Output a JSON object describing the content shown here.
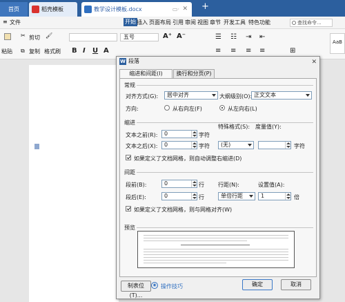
{
  "tabs": {
    "home": "首页",
    "template": "稻壳模板",
    "document": "教学设计模板.docx",
    "new_tab": "+"
  },
  "menu": {
    "items": [
      "文件",
      "开始",
      "插入",
      "页面布局",
      "引用",
      "审阅",
      "视图",
      "章节",
      "开发工具",
      "特色功能"
    ],
    "search_placeholder": "查找命令..."
  },
  "ribbon": {
    "cut": "剪切",
    "copy": "复制",
    "paste": "粘贴",
    "format_painter": "格式刷",
    "font_size": "五号",
    "style_preview": "AaB"
  },
  "dialog": {
    "title": "段落",
    "tabs": [
      "缩进和间距(I)",
      "换行和分页(P)"
    ],
    "general": {
      "section": "常规",
      "alignment_label": "对齐方式(G):",
      "alignment_value": "居中对齐",
      "outline_label": "大纲级别(O):",
      "outline_value": "正文文本",
      "direction_label": "方向:",
      "rtl_label": "从右向左(F)",
      "ltr_label": "从左向右(L)",
      "direction_selected": "ltr"
    },
    "indent": {
      "section": "缩进",
      "before_label": "文本之前(R):",
      "before_value": "0",
      "before_unit": "字符",
      "after_label": "文本之后(X):",
      "after_value": "0",
      "after_unit": "字符",
      "special_label": "特殊格式(S):",
      "special_value": "(无)",
      "measure_label": "度量值(Y):",
      "measure_value": "",
      "measure_unit": "字符",
      "grid_check_label": "如果定义了文档网格，则自动调整右缩进(D)",
      "grid_check": true
    },
    "spacing": {
      "section": "间距",
      "before_label": "段前(B):",
      "before_value": "0",
      "before_unit": "行",
      "after_label": "段后(E):",
      "after_value": "0",
      "after_unit": "行",
      "line_label": "行距(N):",
      "line_value": "单倍行距",
      "set_label": "设置值(A):",
      "set_value": "1",
      "set_unit": "倍",
      "grid_check_label": "如果定义了文档网格，则与网格对齐(W)",
      "grid_check": true
    },
    "preview": {
      "section": "预览"
    },
    "buttons": {
      "tabs": "制表位(T)...",
      "tips": "操作技巧",
      "ok": "确定",
      "cancel": "取消"
    }
  }
}
